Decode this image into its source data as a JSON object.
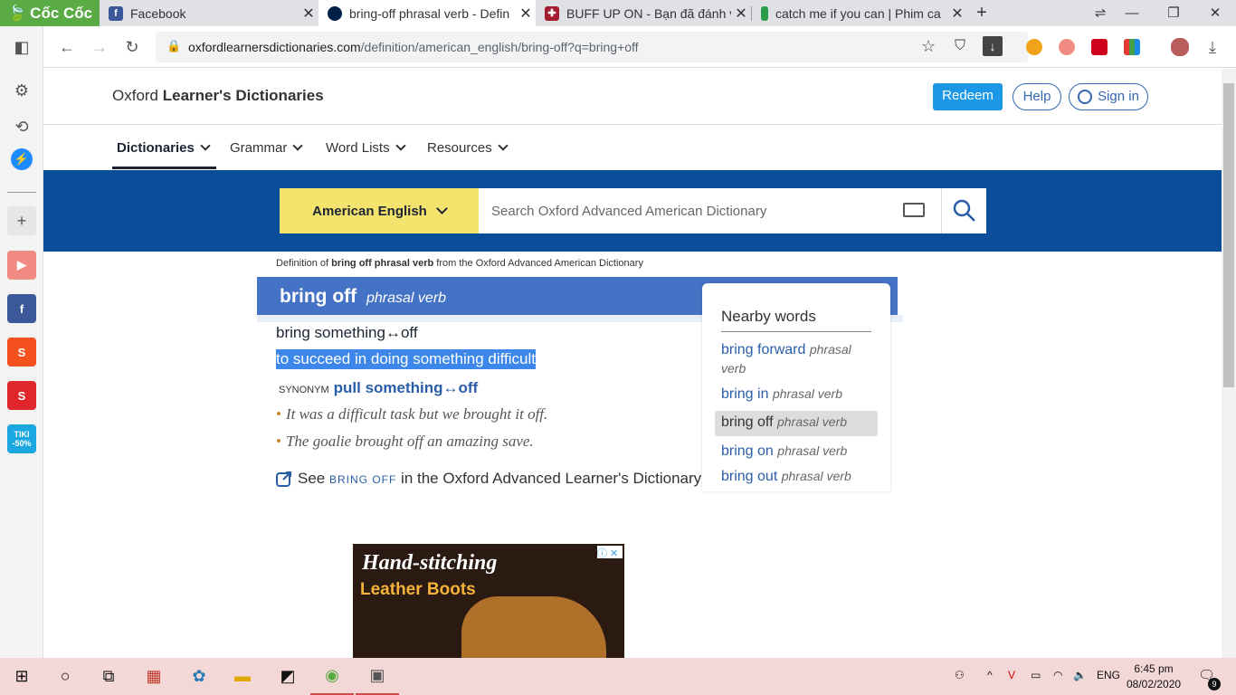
{
  "browser": {
    "brand": "Cốc Cốc",
    "tabs": [
      {
        "title": "Facebook",
        "icon": "facebook-icon"
      },
      {
        "title": "bring-off phrasal verb - Defin",
        "icon": "oxford-icon"
      },
      {
        "title": "BUFF UP ON - Bạn đã đánh v",
        "icon": "cambridge-icon"
      },
      {
        "title": "catch me if you can | Phim ca",
        "icon": "phim-icon"
      }
    ],
    "new_tab": "+",
    "url_domain": "oxfordlearnersdictionaries.com",
    "url_path": "/definition/american_english/bring-off?q=bring+off"
  },
  "site": {
    "logo_plain": "Oxford ",
    "logo_bold": "Learner's Dictionaries",
    "redeem": "Redeem",
    "help": "Help",
    "signin": "Sign in",
    "menu": [
      "Dictionaries",
      "Grammar",
      "Word Lists",
      "Resources"
    ],
    "dict_select": "American English",
    "search_placeholder": "Search Oxford Advanced American Dictionary"
  },
  "entry": {
    "crumb_pre": "Definition of ",
    "crumb_bold": "bring off phrasal verb",
    "crumb_post": " from the Oxford Advanced American Dictionary",
    "headword": "bring off",
    "pos": "phrasal verb",
    "pattern": "bring something↔off",
    "definition": "to succeed in doing something difficult",
    "synonym_label": "SYNONYM",
    "synonym": "pull something↔off",
    "examples": [
      "It was a difficult task but we brought it off.",
      "The goalie brought off an amazing save."
    ],
    "see_pre": "See ",
    "see_word": "bring off",
    "see_post": " in the Oxford Advanced Learner's Dictionary"
  },
  "nearby": {
    "title": "Nearby words",
    "items": [
      {
        "word": "bring forward",
        "pos": "phrasal verb"
      },
      {
        "word": "bring in",
        "pos": "phrasal verb"
      },
      {
        "word": "bring off",
        "pos": "phrasal verb"
      },
      {
        "word": "bring on",
        "pos": "phrasal verb"
      },
      {
        "word": "bring out",
        "pos": "phrasal verb"
      }
    ]
  },
  "ad": {
    "line1": "Hand-stitching",
    "line2": "Leather Boots"
  },
  "sidebar": {
    "tiki_label": "TIKI -50%"
  },
  "taskbar": {
    "lang": "ENG",
    "time": "6:45 pm",
    "date": "08/02/2020",
    "notifications": "9"
  }
}
